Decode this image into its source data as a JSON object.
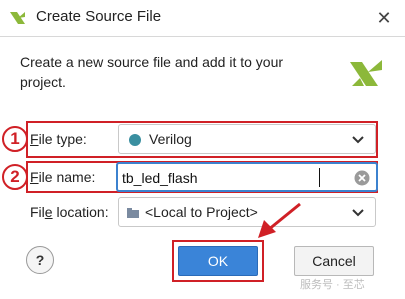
{
  "dialog": {
    "title": "Create Source File",
    "description": "Create a new source file and add it to your project."
  },
  "fields": {
    "file_type": {
      "label_ul": "F",
      "label_rest": "ile type:",
      "value": "Verilog"
    },
    "file_name": {
      "label_ul": "F",
      "label_rest": "ile name:",
      "value": "tb_led_flash"
    },
    "file_location": {
      "label_pre": "Fil",
      "label_ul": "e",
      "label_rest": " location:",
      "value": "<Local to Project>"
    }
  },
  "buttons": {
    "help": "?",
    "ok": "OK",
    "cancel": "Cancel"
  },
  "annotations": {
    "marker_1": "1",
    "marker_2": "2",
    "color": "#d02026"
  },
  "watermark": "服务号 · 至芯",
  "colors": {
    "accent": "#3a84d8",
    "input_border": "#3c82cf",
    "verilog_dot": "#3a8fa0",
    "logo_green": "#8cb83a"
  }
}
